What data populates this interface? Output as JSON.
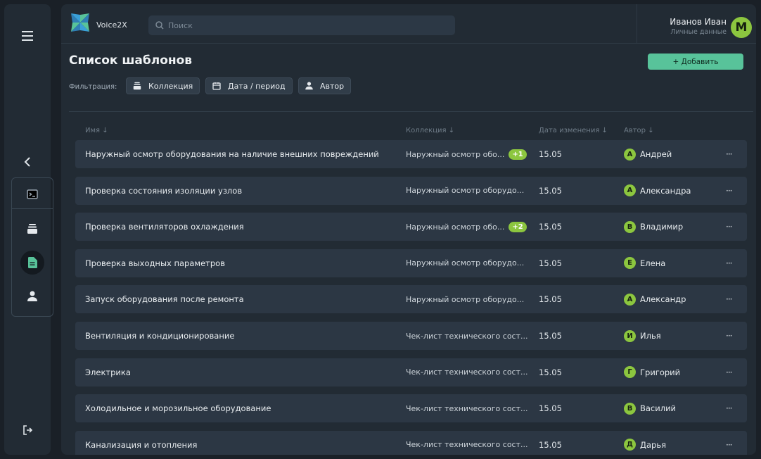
{
  "app": {
    "brand": "Voice2X"
  },
  "search": {
    "placeholder": "Поиск"
  },
  "user": {
    "name": "Иванов Иван",
    "subtitle": "Личные данные",
    "initial": "M"
  },
  "page": {
    "title": "Список шаблонов",
    "add_label": "+ Добавить"
  },
  "filters": {
    "label": "Фильтрация:",
    "collection": "Коллекция",
    "date": "Дата / период",
    "author": "Автор"
  },
  "table": {
    "headers": {
      "name": "Имя ↓",
      "collection": "Коллекция ↓",
      "date": "Дата изменения ↓",
      "author": "Автор ↓"
    },
    "rows": [
      {
        "name": "Наружный осмотр оборудования на наличие внешних повреждений",
        "collection": "Наружный осмотр обо...",
        "badge": "+1",
        "date": "15.05",
        "author_initial": "А",
        "author": "Андрей",
        "more": "···"
      },
      {
        "name": "Проверка состояния изоляции узлов",
        "collection": "Наружный осмотр оборудо...",
        "badge": "",
        "date": "15.05",
        "author_initial": "А",
        "author": "Александра",
        "more": "···"
      },
      {
        "name": "Проверка вентиляторов охлаждения",
        "collection": "Наружный осмотр обо...",
        "badge": "+2",
        "date": "15.05",
        "author_initial": "В",
        "author": "Владимир",
        "more": "···"
      },
      {
        "name": "Проверка выходных параметров",
        "collection": "Наружный осмотр оборудо...",
        "badge": "",
        "date": "15.05",
        "author_initial": "Е",
        "author": "Елена",
        "more": "···"
      },
      {
        "name": "Запуск оборудования после ремонта",
        "collection": "Наружный осмотр оборудо...",
        "badge": "",
        "date": "15.05",
        "author_initial": "А",
        "author": "Александр",
        "more": "···"
      },
      {
        "name": "Вентиляция и кондиционирование",
        "collection": "Чек-лист технического сост...",
        "badge": "",
        "date": "15.05",
        "author_initial": "И",
        "author": "Илья",
        "more": "···"
      },
      {
        "name": "Электрика",
        "collection": "Чек-лист технического сост...",
        "badge": "",
        "date": "15.05",
        "author_initial": "Г",
        "author": "Григорий",
        "more": "···"
      },
      {
        "name": "Холодильное и морозильное оборудование",
        "collection": "Чек-лист технического сост...",
        "badge": "",
        "date": "15.05",
        "author_initial": "В",
        "author": "Василий",
        "more": "···"
      },
      {
        "name": "Канализация и отопления",
        "collection": "Чек-лист технического сост...",
        "badge": "",
        "date": "15.05",
        "author_initial": "Д",
        "author": "Дарья",
        "more": "···"
      }
    ]
  },
  "colors": {
    "accent": "#58c39a",
    "badge": "#8cc63f",
    "panel": "#222b34",
    "row": "#2c3744"
  }
}
